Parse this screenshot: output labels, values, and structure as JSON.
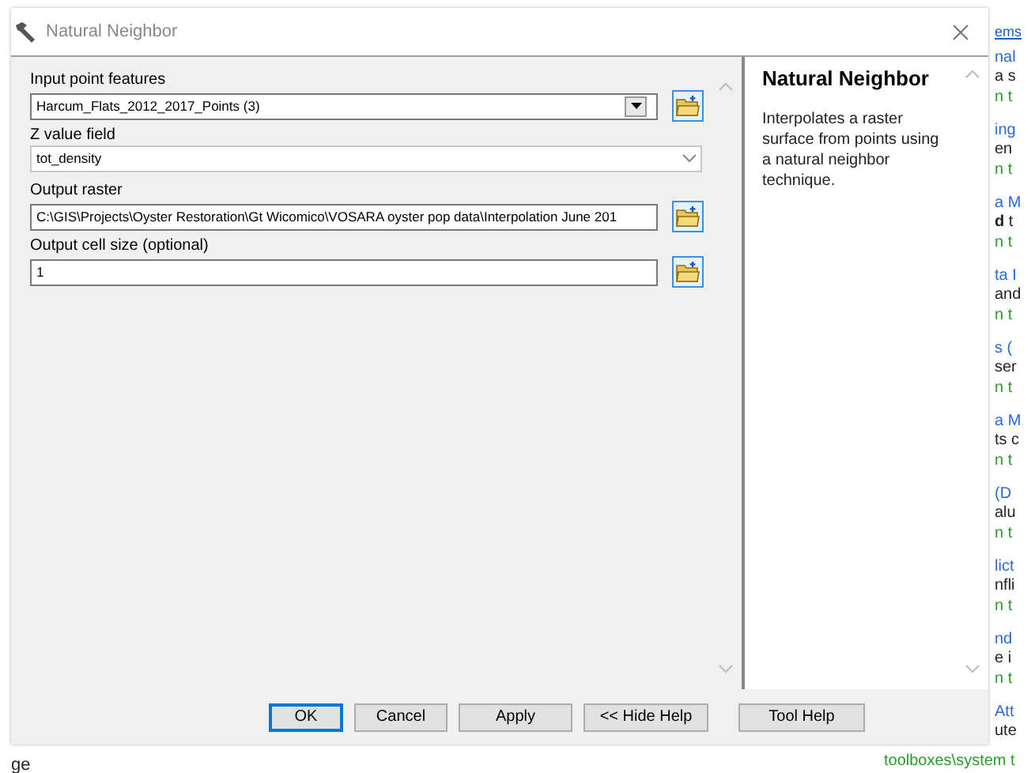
{
  "window": {
    "title": "Natural Neighbor"
  },
  "parameters": [
    {
      "label": "Input point features",
      "kind": "dropdown",
      "value": "Harcum_Flats_2012_2017_Points (3)"
    },
    {
      "label": "Z value field",
      "kind": "select",
      "value": "tot_density"
    },
    {
      "label": "Output raster",
      "kind": "path",
      "value": "C:\\GIS\\Projects\\Oyster Restoration\\Gt Wicomico\\VOSARA oyster pop data\\Interpolation June 201"
    },
    {
      "label": "Output cell size (optional)",
      "kind": "path",
      "value": "1"
    }
  ],
  "help": {
    "title": "Natural Neighbor",
    "text": "Interpolates a raster surface from points using a natural neighbor technique."
  },
  "buttons": [
    {
      "label": "OK",
      "default": true
    },
    {
      "label": "Cancel",
      "default": false
    },
    {
      "label": "Apply",
      "default": false
    },
    {
      "label": "<< Hide Help",
      "default": false
    },
    {
      "label": "Tool Help",
      "default": false
    }
  ],
  "background": {
    "header_link": "ems",
    "results": [
      {
        "title": "nal",
        "description": "a s",
        "path": "n t"
      },
      {
        "title": "ing",
        "description": "en",
        "path": "n t"
      },
      {
        "title": "a M",
        "description": "**d** t",
        "path": "n t"
      },
      {
        "title": "ta I",
        "description": "and",
        "path": "n t"
      },
      {
        "title": "s (",
        "description": "ser",
        "path": "n t"
      },
      {
        "title": "a M",
        "description": "ts c",
        "path": "n t"
      },
      {
        "title": "(D",
        "description": "alu",
        "path": "n t"
      },
      {
        "title": "lict",
        "description": "nfli",
        "path": "n t"
      },
      {
        "title": "nd",
        "description": "e i",
        "path": "n t"
      },
      {
        "title": "Att",
        "description": "ute",
        "path": "toolboxes\\system t"
      }
    ],
    "bottom_left": "ge"
  }
}
